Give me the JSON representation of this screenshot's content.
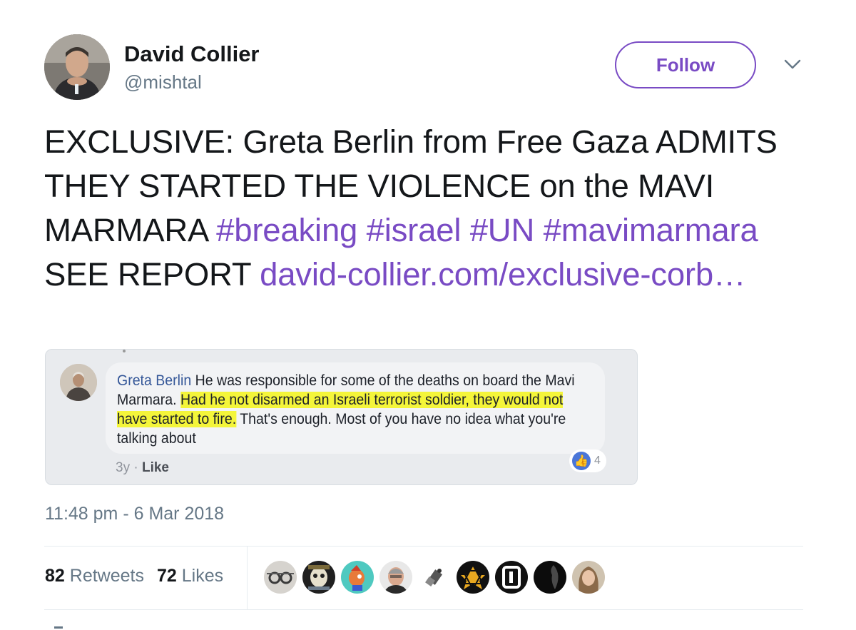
{
  "user": {
    "name": "David Collier",
    "handle": "@mishtal",
    "follow_label": "Follow"
  },
  "tweet": {
    "p1": "EXCLUSIVE: Greta Berlin from Free Gaza ADMITS THEY STARTED THE VIOLENCE on the MAVI MARMARA ",
    "tag1": "#breaking",
    "tag2": "#israel",
    "tag3": "#UN",
    "tag4": "#mavimarmara",
    "p2": " SEE REPORT ",
    "link": "david-collier.com/exclusive-corb…"
  },
  "media": {
    "author": "Greta Berlin",
    "text_a": " He was responsible for some of the deaths on board the Mavi Marmara. ",
    "text_highlight": "Had he not disarmed an Israeli terrorist soldier, they would not have started to fire.",
    "text_b": " That's enough. Most of you have no idea what you're talking about",
    "age": "3y",
    "separator": " · ",
    "like_label": "Like",
    "reaction_count": "4"
  },
  "timestamp": "11:48 pm - 6 Mar 2018",
  "stats": {
    "retweets_count": "82",
    "retweets_label": "Retweets",
    "likes_count": "72",
    "likes_label": "Likes"
  },
  "colors": {
    "accent": "#794bc4",
    "secondary_text": "#657786",
    "highlight": "#f4f53a",
    "fb_link": "#365899"
  },
  "likers": [
    {
      "icon": "liker-avatar-glasses"
    },
    {
      "icon": "liker-avatar-skull"
    },
    {
      "icon": "liker-avatar-cartoon"
    },
    {
      "icon": "liker-avatar-man"
    },
    {
      "icon": "liker-avatar-robot"
    },
    {
      "icon": "liker-avatar-star"
    },
    {
      "icon": "liker-avatar-letter"
    },
    {
      "icon": "liker-avatar-dark"
    },
    {
      "icon": "liker-avatar-woman"
    }
  ]
}
